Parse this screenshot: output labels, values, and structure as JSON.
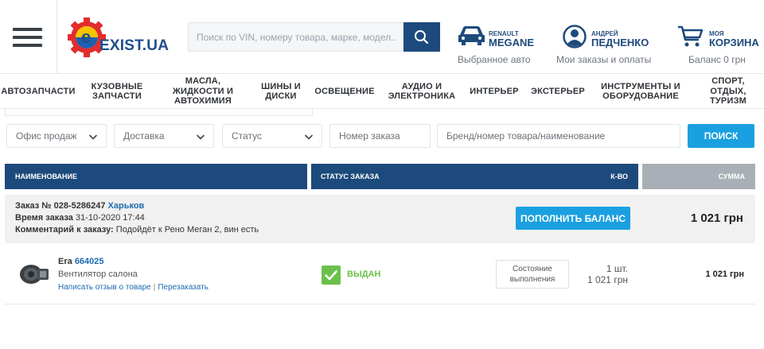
{
  "header": {
    "logo_text": "EXIST.UA",
    "search_placeholder": "Поиск по VIN, номеру товара, марке, модел...",
    "car": {
      "brand": "RENAULT",
      "model": "MEGANE",
      "caption": "Выбранное авто"
    },
    "user": {
      "first_name": "АНДРЕЙ",
      "last_name": "ПЕДЧЕНКО",
      "caption": "Мои заказы и оплаты"
    },
    "cart": {
      "top": "МОЯ",
      "title": "КОРЗИНА",
      "caption": "Баланс 0 грн"
    }
  },
  "categories": [
    "Автозапчасти",
    "Кузовные запчасти",
    "Масла, жидкости и автохимия",
    "Шины и диски",
    "Освещение",
    "Аудио и электроника",
    "Интерьер",
    "Экстерьер",
    "Инструменты и оборудование",
    "Спорт, отдых, туризм"
  ],
  "filters": {
    "office": "Офис продаж",
    "delivery": "Доставка",
    "status": "Статус",
    "order_number_placeholder": "Номер заказа",
    "product_placeholder": "Бренд/номер товара/наименование",
    "search_button": "ПОИСК"
  },
  "table_header": {
    "name": "НАИМЕНОВАНИЕ",
    "status": "СТАТУС ЗАКАЗА",
    "qty": "К-ВО",
    "sum": "СУММА"
  },
  "order": {
    "number_label": "Заказ №",
    "number": "028-5286247",
    "city": "Харьков",
    "time_label": "Время заказа",
    "time": "31-10-2020 17:44",
    "comment_label": "Комментарий к заказу:",
    "comment": "Подойдёт к Рено Меган 2, вин есть",
    "topup_button": "ПОПОЛНИТЬ БАЛАНС",
    "total": "1 021 грн"
  },
  "item": {
    "brand": "Era",
    "code": "664025",
    "description": "Вентилятор салона",
    "review_link": "Написать отзыв о товаре",
    "separator": "|",
    "reorder_link": "Перезаказать",
    "status": "ВЫДАН",
    "state_button": "Состояние выполнения",
    "qty": "1 шт.",
    "price": "1 021 грн",
    "total": "1 021 грн"
  },
  "colors": {
    "brand_blue": "#1d4a7c",
    "action_blue": "#1aa0e0",
    "success_green": "#6cc04a",
    "sum_header_gray": "#a9afb6"
  }
}
